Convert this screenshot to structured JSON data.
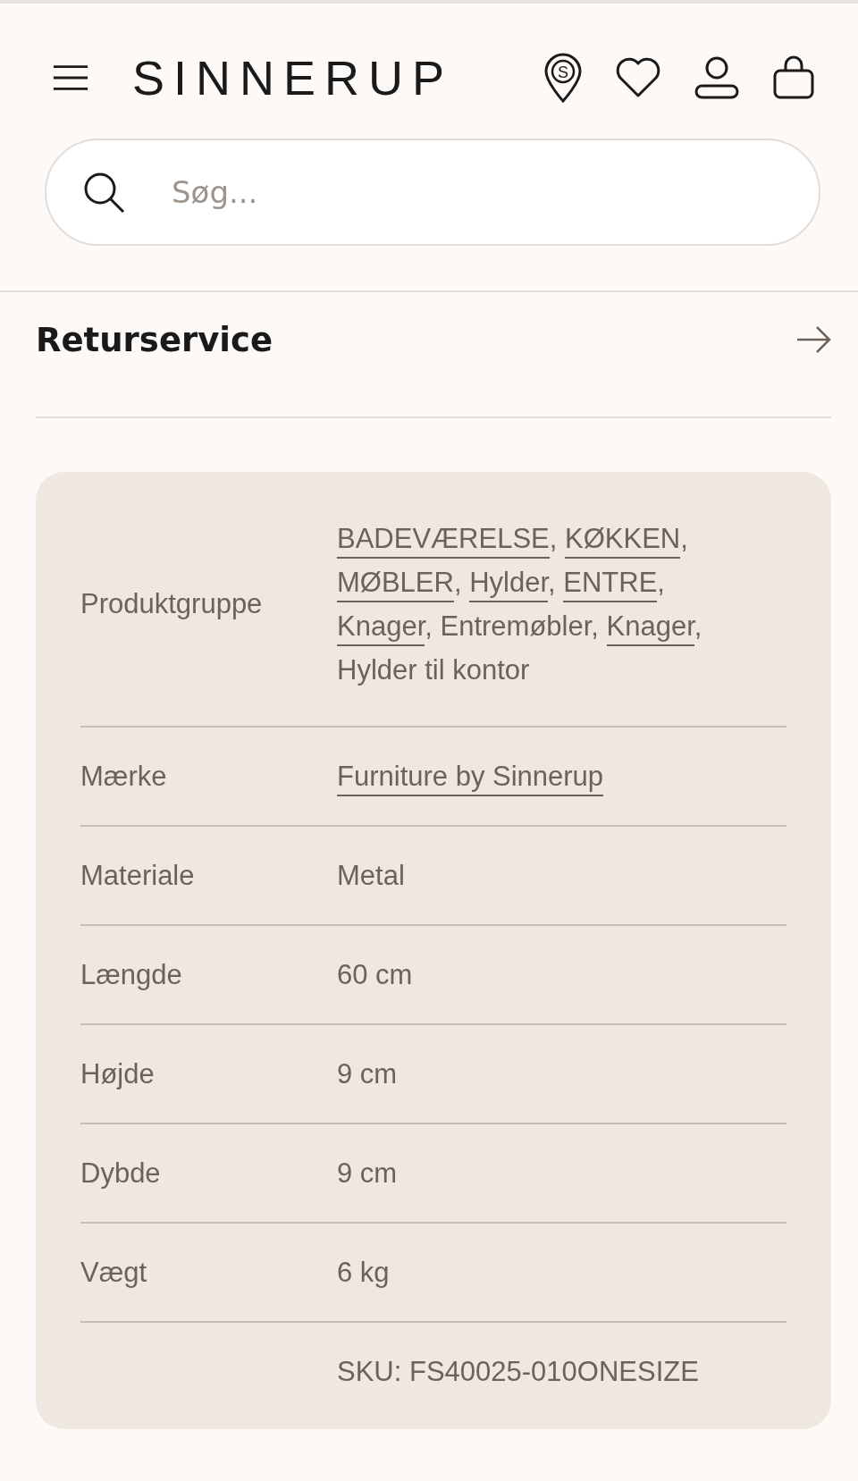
{
  "header": {
    "logo": "SINNERUP",
    "store_letter": "S"
  },
  "search": {
    "placeholder": "Søg..."
  },
  "section": {
    "title": "Returservice"
  },
  "specs": [
    {
      "label": "Produktgruppe",
      "segments": [
        {
          "text": "BADEVÆRELSE",
          "linked": true,
          "suffix": ", "
        },
        {
          "text": "KØKKEN",
          "linked": true,
          "suffix": ", "
        },
        {
          "text": "MØBLER",
          "linked": true,
          "suffix": ", "
        },
        {
          "text": "Hylder",
          "linked": true,
          "suffix": ", "
        },
        {
          "text": "ENTRE",
          "linked": true,
          "suffix": ", "
        },
        {
          "text": "Knager",
          "linked": true,
          "suffix": ", "
        },
        {
          "text": "Entremøbler",
          "linked": false,
          "suffix": ", "
        },
        {
          "text": "Knager",
          "linked": true,
          "suffix": ", "
        },
        {
          "text": "Hylder til kontor",
          "linked": false
        }
      ]
    },
    {
      "label": "Mærke",
      "segments": [
        {
          "text": "Furniture by Sinnerup",
          "linked": true
        }
      ]
    },
    {
      "label": "Materiale",
      "segments": [
        {
          "text": "Metal",
          "linked": false
        }
      ]
    },
    {
      "label": "Længde",
      "segments": [
        {
          "text": "60 cm",
          "linked": false
        }
      ]
    },
    {
      "label": "Højde",
      "segments": [
        {
          "text": "9 cm",
          "linked": false
        }
      ]
    },
    {
      "label": "Dybde",
      "segments": [
        {
          "text": "9 cm",
          "linked": false
        }
      ]
    },
    {
      "label": "Vægt",
      "segments": [
        {
          "text": "6 kg",
          "linked": false
        }
      ]
    },
    {
      "segments": [
        {
          "text": "SKU: FS40025-010ONESIZE",
          "linked": false
        }
      ]
    }
  ]
}
